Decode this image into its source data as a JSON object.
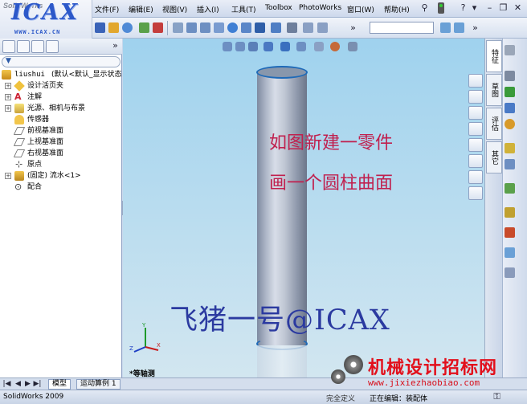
{
  "app": {
    "brand": "SolidWorks",
    "logo_text": "ICAX",
    "logo_url": "WWW.ICAX.CN"
  },
  "menu": {
    "items": [
      "文件(F)",
      "编辑(E)",
      "视图(V)",
      "插入(I)",
      "工具(T)",
      "Toolbox",
      "PhotoWorks",
      "窗口(W)",
      "帮助(H)"
    ],
    "help_glyph": "?"
  },
  "feature_tree": {
    "root": "liushui",
    "root_config": "(默认<默认_显示状态",
    "items": [
      {
        "label": "设计活页夹",
        "expandable": true
      },
      {
        "label": "注解",
        "expandable": true
      },
      {
        "label": "光源、相机与布景",
        "expandable": true
      },
      {
        "label": "传感器",
        "expandable": false
      },
      {
        "label": "前视基准面",
        "expandable": false
      },
      {
        "label": "上视基准面",
        "expandable": false
      },
      {
        "label": "右视基准面",
        "expandable": false
      },
      {
        "label": "原点",
        "expandable": false
      },
      {
        "label": "(固定) 流水<1>",
        "expandable": true
      },
      {
        "label": "配合",
        "expandable": false
      }
    ]
  },
  "viewport": {
    "instruction_line1": "如图新建一零件",
    "instruction_line2": "画一个圆柱曲面",
    "signature": "飞猪一号@ICAX",
    "view_name": "*等轴测",
    "triad_axes": [
      "X",
      "Y",
      "Z"
    ]
  },
  "task_pane": {
    "tabs": [
      "特征",
      "草图",
      "评估",
      "其它"
    ]
  },
  "bottom_tabs": [
    "模型",
    "运动算例 1"
  ],
  "status": {
    "version": "SolidWorks 2009",
    "editing": "正在编辑：装配体",
    "resolved": "完全定义"
  },
  "watermark": {
    "title": "机械设计招标网",
    "url": "www.jixiezhaobiao.com"
  },
  "colors": {
    "note_red": "#c0204e",
    "signature_blue": "#2b3aa0",
    "watermark_red": "#e2101c",
    "selection_edge": "#1e6ab8"
  }
}
